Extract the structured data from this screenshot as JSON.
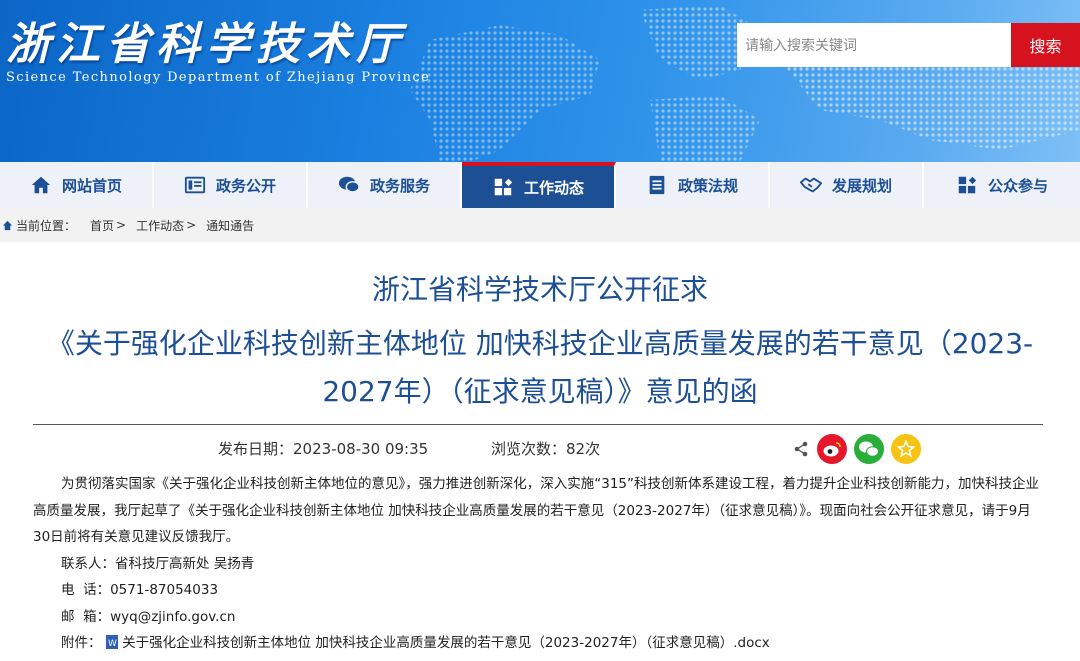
{
  "header": {
    "logo_cn": "浙江省科学技术厅",
    "logo_en": "Science Technology Department of Zhejiang Province",
    "search_placeholder": "请输入搜索关键词",
    "search_button": "搜索"
  },
  "nav": {
    "items": [
      {
        "label": "网站首页",
        "icon": "home-icon"
      },
      {
        "label": "政务公开",
        "icon": "list-icon"
      },
      {
        "label": "政务服务",
        "icon": "chat-icon"
      },
      {
        "label": "工作动态",
        "icon": "work-icon",
        "active": true
      },
      {
        "label": "政策法规",
        "icon": "document-icon"
      },
      {
        "label": "发展规划",
        "icon": "handshake-icon"
      },
      {
        "label": "公众参与",
        "icon": "participate-icon"
      }
    ],
    "active_color": "#1d4f95",
    "accent_color": "#d6121f"
  },
  "breadcrumb": {
    "prefix": "当前位置：",
    "items": [
      "首页",
      "工作动态",
      "通知通告"
    ],
    "separator": ">"
  },
  "article": {
    "title_line1": "浙江省科学技术厅公开征求",
    "title_line2": "《关于强化企业科技创新主体地位 加快科技企业高质量发展的若干意见（2023-2027年）（征求意见稿）》意见的函",
    "date_label": "发布日期：",
    "date_value": "2023-08-30 09:35",
    "views_label": "浏览次数：",
    "views_value": "82次",
    "intro": "为贯彻落实国家《关于强化企业科技创新主体地位的意见》，强力推进创新深化，深入实施“315”科技创新体系建设工程，着力提升企业科技创新能力，加快科技企业高质量发展，我厅起草了《关于强化企业科技创新主体地位 加快科技企业高质量发展的若干意见（2023-2027年）（征求意见稿）》。现面向社会公开征求意见，请于9月30日前将有关意见建议反馈我厅。",
    "contact_label": "联系人：",
    "contact_value": "省科技厅高新处 吴扬青",
    "phone_label": "电  话：",
    "phone_value": "0571-87054033",
    "email_label": "邮  箱：",
    "email_value": "wyq@zjinfo.gov.cn",
    "attachment_label": "附件：",
    "attachment_value": "关于强化企业科技创新主体地位 加快科技企业高质量发展的若干意见（2023-2027年）（征求意见稿）.docx"
  },
  "share": {
    "icons": [
      "share-icon",
      "weibo-icon",
      "wechat-icon",
      "favorite-icon"
    ]
  }
}
